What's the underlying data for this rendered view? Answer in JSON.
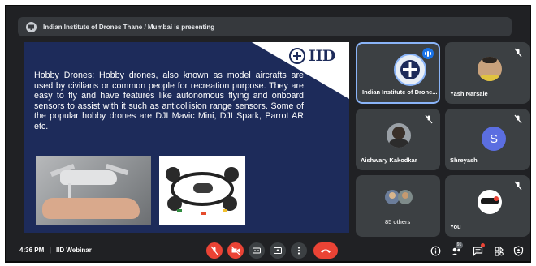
{
  "banner": {
    "text": "Indian Institute of Drones Thane / Mumbai is presenting",
    "icon": "presenting-icon"
  },
  "slide": {
    "logo_text": "IID",
    "keyword": "Hobby Drones:",
    "body": " Hobby drones, also known as model aircrafts are used by civilians or common people for recreation purpose. They are easy to fly and have features like autonomous flying and onboard sensors to assist with it such as anticollision range sensors. Some of the popular hobby drones are DJI Mavic Mini, DJI Spark, Parrot AR etc.",
    "images": [
      "drone-photo-hand",
      "drone-photo-parrot"
    ]
  },
  "participants": [
    {
      "name": "Indian Institute of Drone...",
      "speaking": true
    },
    {
      "name": "Yash Narsale",
      "muted": true
    },
    {
      "name": "Aishwary Kakodkar",
      "muted": true
    },
    {
      "name": "Shreyash",
      "initial": "S",
      "muted": true,
      "color": "#5b6ee1"
    },
    {
      "name": "85 others"
    },
    {
      "name": "You",
      "muted": true
    }
  ],
  "bottom": {
    "time": "4:36 PM",
    "separator": "|",
    "meeting_name": "IID Webinar",
    "people_count": "91",
    "controls": [
      "mic-off-icon",
      "camera-off-icon",
      "captions-icon",
      "present-icon",
      "more-icon",
      "hangup-icon"
    ],
    "right_icons": [
      "info-icon",
      "people-icon",
      "chat-icon",
      "activities-icon",
      "host-controls-icon"
    ]
  },
  "colors": {
    "accent": "#8ab4f8",
    "danger": "#ea4335",
    "slide_bg": "#1d2b5a",
    "tile_bg": "#3c4043"
  }
}
